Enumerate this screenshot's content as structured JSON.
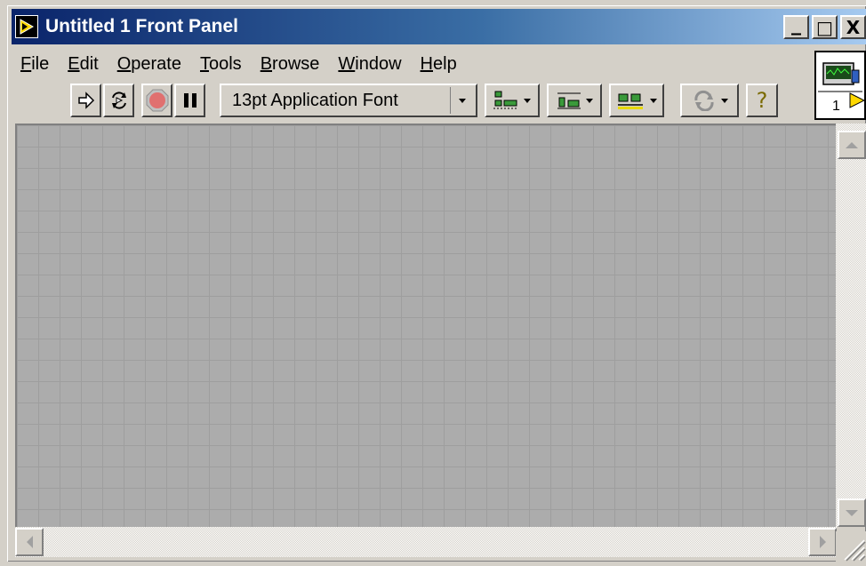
{
  "window": {
    "title": "Untitled 1 Front Panel",
    "caption": {
      "minimize": "_",
      "maximize": "□",
      "close": "X"
    }
  },
  "menu": {
    "items": [
      {
        "label_u": "F",
        "label_rest": "ile"
      },
      {
        "label_u": "E",
        "label_rest": "dit"
      },
      {
        "label_u": "O",
        "label_rest": "perate"
      },
      {
        "label_u": "T",
        "label_rest": "ools"
      },
      {
        "label_u": "B",
        "label_rest": "rowse"
      },
      {
        "label_u": "W",
        "label_rest": "indow"
      },
      {
        "label_u": "H",
        "label_rest": "elp"
      }
    ]
  },
  "toolbar": {
    "run_icon": "run-arrow-icon",
    "run_continuous_icon": "run-continuously-icon",
    "abort_icon": "abort-execution-icon",
    "pause_icon": "pause-icon",
    "font": "13pt Application Font",
    "align_icon": "align-objects-icon",
    "distribute_icon": "distribute-objects-icon",
    "resize_icon": "resize-objects-icon",
    "reorder_icon": "reorder-icon",
    "help_glyph": "?"
  },
  "connector": {
    "terminal_label": "1"
  },
  "colors": {
    "title_start": "#0a246a",
    "title_end": "#a6caf0",
    "panel_bg": "#acacac",
    "grid_line": "#9e9e9e",
    "abort_red": "#e07070"
  }
}
